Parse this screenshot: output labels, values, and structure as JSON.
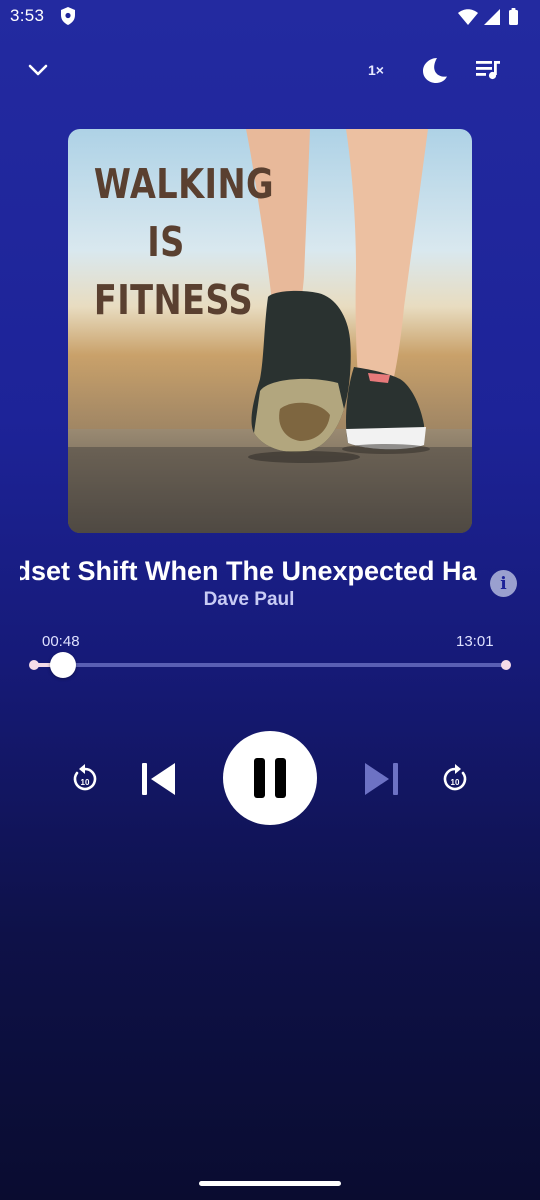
{
  "status_bar": {
    "time": "3:53",
    "icons": [
      "shield-icon",
      "wifi-icon",
      "signal-icon",
      "battery-icon"
    ]
  },
  "toolbar": {
    "collapse_icon": "chevron-down-icon",
    "speed_label": "1×",
    "sleep_icon": "moon-icon",
    "queue_icon": "playlist-icon"
  },
  "artwork": {
    "text": "WALKING IS FITNESS",
    "lines": [
      "WALKING",
      "IS",
      "FITNESS"
    ]
  },
  "track": {
    "title": "Mindset Shift When The Unexpected Happens",
    "artist": "Dave Paul",
    "info_icon": "info-icon"
  },
  "progress": {
    "elapsed": "00:48",
    "total": "13:01",
    "fraction": 0.061
  },
  "controls": {
    "rewind_label": "10",
    "forward_label": "10",
    "rewind_icon": "replay-10-icon",
    "previous_icon": "skip-previous-icon",
    "play_state_icon": "pause-icon",
    "next_icon": "skip-next-icon",
    "forward_icon": "forward-10-icon"
  },
  "colors": {
    "background_top": "#232aa0",
    "background_bottom": "#0a0c30",
    "progress_fill": "#f3dbe8",
    "progress_track": "#5a5fb4",
    "artwork_text": "#5a4030"
  }
}
